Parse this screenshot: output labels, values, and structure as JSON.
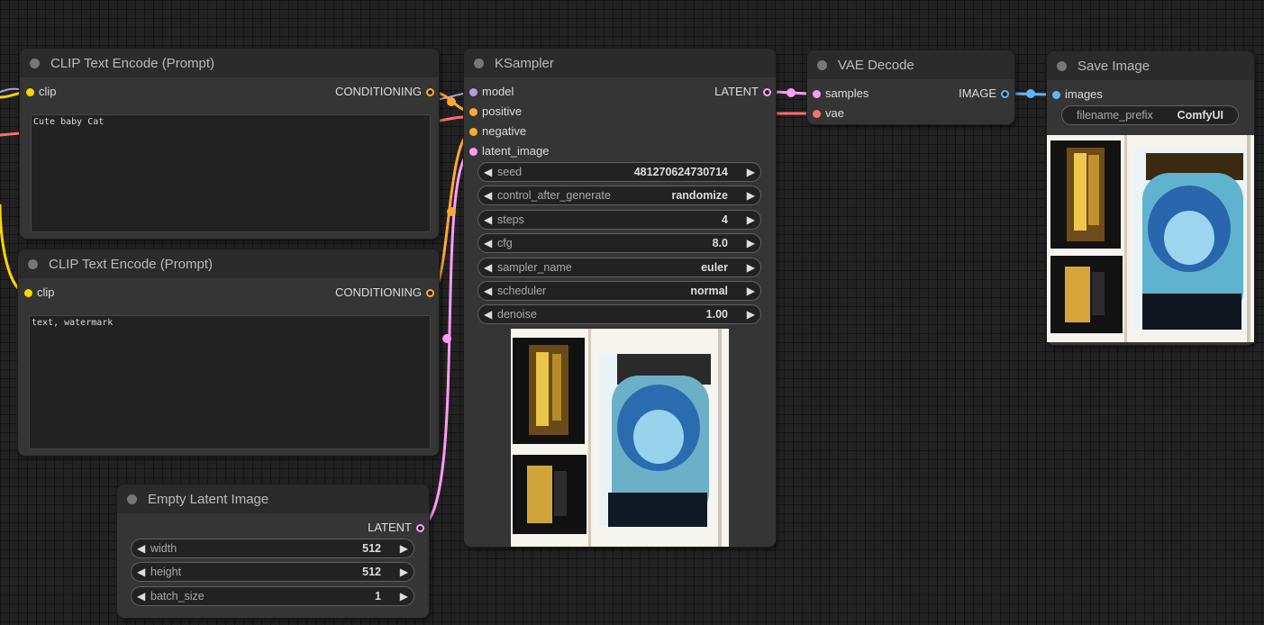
{
  "colors": {
    "clip": "#ffd500",
    "conditioning": "#ffa931",
    "model": "#b39ddb",
    "latent": "#ff9cf9",
    "vae": "#ff6e6e",
    "image": "#64b5f6"
  },
  "clip_pos": {
    "title": "CLIP Text Encode (Prompt)",
    "input_clip": "clip",
    "output": "CONDITIONING",
    "text": "Cute baby Cat"
  },
  "clip_neg": {
    "title": "CLIP Text Encode (Prompt)",
    "input_clip": "clip",
    "output": "CONDITIONING",
    "text": "text, watermark"
  },
  "empty_latent": {
    "title": "Empty Latent Image",
    "output": "LATENT",
    "widgets": [
      {
        "label": "width",
        "value": "512"
      },
      {
        "label": "height",
        "value": "512"
      },
      {
        "label": "batch_size",
        "value": "1"
      }
    ]
  },
  "ksampler": {
    "title": "KSampler",
    "inputs": [
      "model",
      "positive",
      "negative",
      "latent_image"
    ],
    "output": "LATENT",
    "widgets": [
      {
        "label": "seed",
        "value": "481270624730714"
      },
      {
        "label": "control_after_generate",
        "value": "randomize"
      },
      {
        "label": "steps",
        "value": "4"
      },
      {
        "label": "cfg",
        "value": "8.0"
      },
      {
        "label": "sampler_name",
        "value": "euler"
      },
      {
        "label": "scheduler",
        "value": "normal"
      },
      {
        "label": "denoise",
        "value": "1.00"
      }
    ]
  },
  "vae_decode": {
    "title": "VAE Decode",
    "inputs": [
      "samples",
      "vae"
    ],
    "output": "IMAGE"
  },
  "save_image": {
    "title": "Save Image",
    "input": "images",
    "widget": {
      "label": "filename_prefix",
      "value": "ComfyUI"
    }
  },
  "arrows": {
    "left": "◀",
    "right": "▶"
  }
}
